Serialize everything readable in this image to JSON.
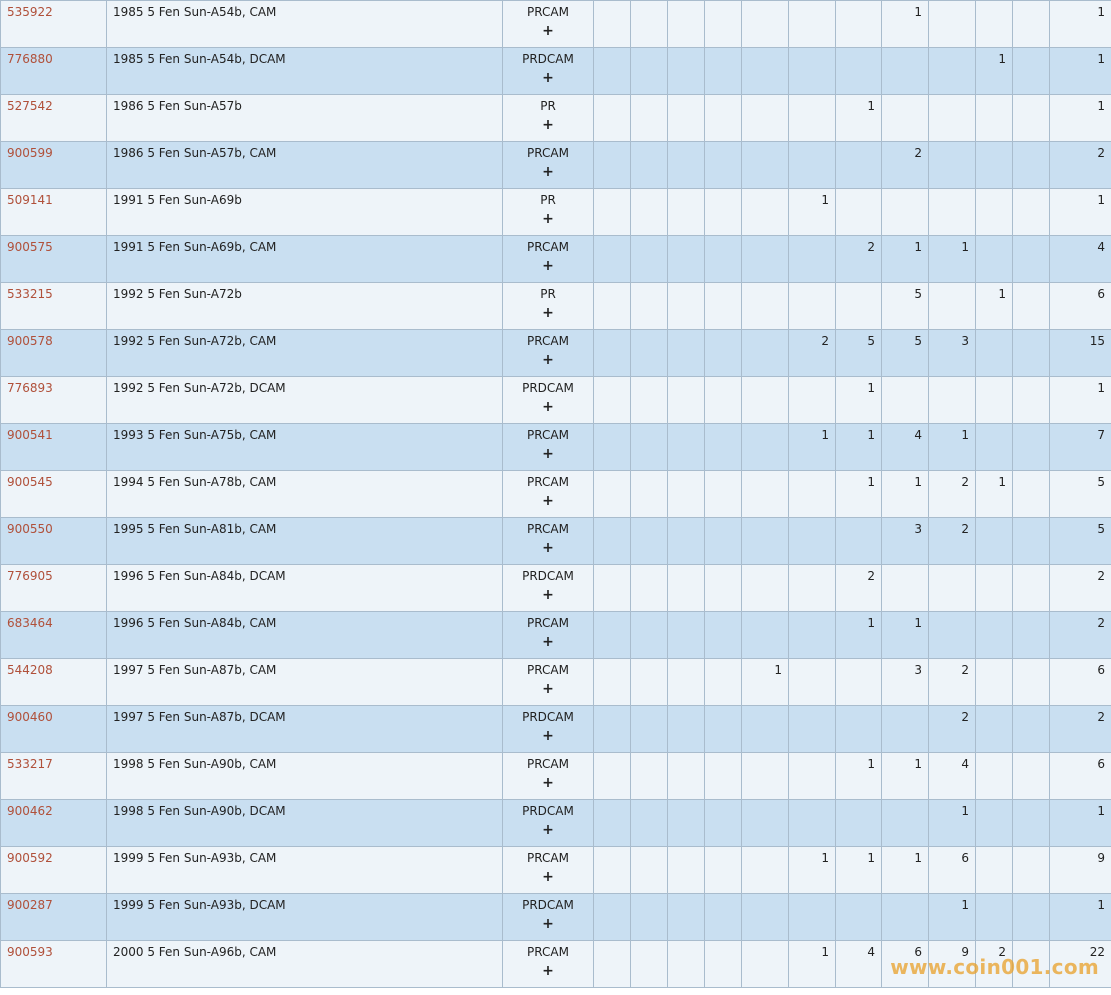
{
  "rows": [
    {
      "pcgs": "535922",
      "desc": "1985 5 Fen Sun-A54b, CAM",
      "des": "PRCAM",
      "counts": [
        "",
        "",
        "",
        "",
        "",
        "",
        "",
        "1",
        "",
        "",
        "",
        "1"
      ]
    },
    {
      "pcgs": "776880",
      "desc": "1985 5 Fen Sun-A54b, DCAM",
      "des": "PRDCAM",
      "counts": [
        "",
        "",
        "",
        "",
        "",
        "",
        "",
        "",
        "",
        "1",
        "",
        "1"
      ]
    },
    {
      "pcgs": "527542",
      "desc": "1986 5 Fen Sun-A57b",
      "des": "PR",
      "counts": [
        "",
        "",
        "",
        "",
        "",
        "",
        "1",
        "",
        "",
        "",
        "",
        "1"
      ]
    },
    {
      "pcgs": "900599",
      "desc": "1986 5 Fen Sun-A57b, CAM",
      "des": "PRCAM",
      "counts": [
        "",
        "",
        "",
        "",
        "",
        "",
        "",
        "2",
        "",
        "",
        "",
        "2"
      ]
    },
    {
      "pcgs": "509141",
      "desc": "1991 5 Fen Sun-A69b",
      "des": "PR",
      "counts": [
        "",
        "",
        "",
        "",
        "",
        "1",
        "",
        "",
        "",
        "",
        "",
        "1"
      ]
    },
    {
      "pcgs": "900575",
      "desc": "1991 5 Fen Sun-A69b, CAM",
      "des": "PRCAM",
      "counts": [
        "",
        "",
        "",
        "",
        "",
        "",
        "2",
        "1",
        "1",
        "",
        "",
        "4"
      ]
    },
    {
      "pcgs": "533215",
      "desc": "1992 5 Fen Sun-A72b",
      "des": "PR",
      "counts": [
        "",
        "",
        "",
        "",
        "",
        "",
        "",
        "5",
        "",
        "1",
        "",
        "6"
      ]
    },
    {
      "pcgs": "900578",
      "desc": "1992 5 Fen Sun-A72b, CAM",
      "des": "PRCAM",
      "counts": [
        "",
        "",
        "",
        "",
        "",
        "2",
        "5",
        "5",
        "3",
        "",
        "",
        "15"
      ]
    },
    {
      "pcgs": "776893",
      "desc": "1992 5 Fen Sun-A72b, DCAM",
      "des": "PRDCAM",
      "counts": [
        "",
        "",
        "",
        "",
        "",
        "",
        "1",
        "",
        "",
        "",
        "",
        "1"
      ]
    },
    {
      "pcgs": "900541",
      "desc": "1993 5 Fen Sun-A75b, CAM",
      "des": "PRCAM",
      "counts": [
        "",
        "",
        "",
        "",
        "",
        "1",
        "1",
        "4",
        "1",
        "",
        "",
        "7"
      ]
    },
    {
      "pcgs": "900545",
      "desc": "1994 5 Fen Sun-A78b, CAM",
      "des": "PRCAM",
      "counts": [
        "",
        "",
        "",
        "",
        "",
        "",
        "1",
        "1",
        "2",
        "1",
        "",
        "5"
      ]
    },
    {
      "pcgs": "900550",
      "desc": "1995 5 Fen Sun-A81b, CAM",
      "des": "PRCAM",
      "counts": [
        "",
        "",
        "",
        "",
        "",
        "",
        "",
        "3",
        "2",
        "",
        "",
        "5"
      ]
    },
    {
      "pcgs": "776905",
      "desc": "1996 5 Fen Sun-A84b, DCAM",
      "des": "PRDCAM",
      "counts": [
        "",
        "",
        "",
        "",
        "",
        "",
        "2",
        "",
        "",
        "",
        "",
        "2"
      ]
    },
    {
      "pcgs": "683464",
      "desc": "1996 5 Fen Sun-A84b, CAM",
      "des": "PRCAM",
      "counts": [
        "",
        "",
        "",
        "",
        "",
        "",
        "1",
        "1",
        "",
        "",
        "",
        "2"
      ]
    },
    {
      "pcgs": "544208",
      "desc": "1997 5 Fen Sun-A87b, CAM",
      "des": "PRCAM",
      "counts": [
        "",
        "",
        "",
        "",
        "1",
        "",
        "",
        "3",
        "2",
        "",
        "",
        "6"
      ]
    },
    {
      "pcgs": "900460",
      "desc": "1997 5 Fen Sun-A87b, DCAM",
      "des": "PRDCAM",
      "counts": [
        "",
        "",
        "",
        "",
        "",
        "",
        "",
        "",
        "2",
        "",
        "",
        "2"
      ]
    },
    {
      "pcgs": "533217",
      "desc": "1998 5 Fen Sun-A90b, CAM",
      "des": "PRCAM",
      "counts": [
        "",
        "",
        "",
        "",
        "",
        "",
        "1",
        "1",
        "4",
        "",
        "",
        "6"
      ]
    },
    {
      "pcgs": "900462",
      "desc": "1998 5 Fen Sun-A90b, DCAM",
      "des": "PRDCAM",
      "counts": [
        "",
        "",
        "",
        "",
        "",
        "",
        "",
        "",
        "1",
        "",
        "",
        "1"
      ]
    },
    {
      "pcgs": "900592",
      "desc": "1999 5 Fen Sun-A93b, CAM",
      "des": "PRCAM",
      "counts": [
        "",
        "",
        "",
        "",
        "",
        "1",
        "1",
        "1",
        "6",
        "",
        "",
        "9"
      ]
    },
    {
      "pcgs": "900287",
      "desc": "1999 5 Fen Sun-A93b, DCAM",
      "des": "PRDCAM",
      "counts": [
        "",
        "",
        "",
        "",
        "",
        "",
        "",
        "",
        "1",
        "",
        "",
        "1"
      ]
    },
    {
      "pcgs": "900593",
      "desc": "2000 5 Fen Sun-A96b, CAM",
      "des": "PRCAM",
      "counts": [
        "",
        "",
        "",
        "",
        "",
        "1",
        "4",
        "6",
        "9",
        "2",
        "",
        "22"
      ]
    }
  ],
  "plus_symbol": "+",
  "watermark": "www.coin001.com",
  "colors": {
    "row_light": "#eef4f9",
    "row_dark": "#c9dff1",
    "link": "#b0503a",
    "border": "#a9bccd",
    "watermark": "#e8a028"
  }
}
